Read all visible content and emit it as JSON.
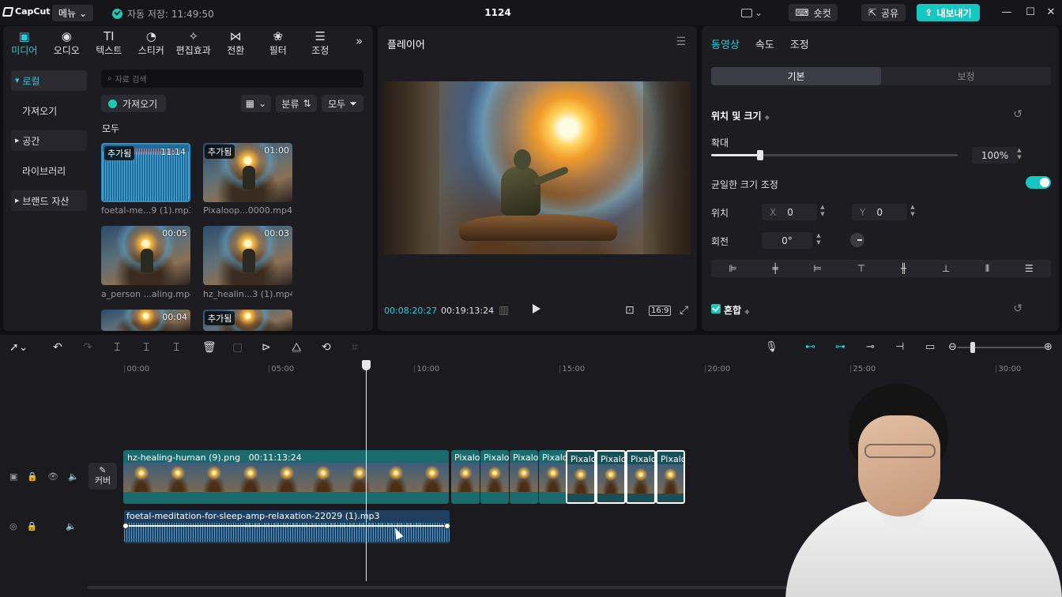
{
  "titlebar": {
    "logo": "CapCut",
    "menu": "메뉴",
    "autosave": "자동 저장: 11:49:50",
    "project": "1124",
    "shortcut": "숏컷",
    "share": "공유",
    "export": "내보내기"
  },
  "tool_tabs": [
    {
      "label": "미디어",
      "icon": "media-icon"
    },
    {
      "label": "오디오",
      "icon": "audio-icon"
    },
    {
      "label": "텍스트",
      "icon": "text-icon"
    },
    {
      "label": "스티커",
      "icon": "sticker-icon"
    },
    {
      "label": "편집효과",
      "icon": "effects-icon"
    },
    {
      "label": "전환",
      "icon": "transition-icon"
    },
    {
      "label": "필터",
      "icon": "filter-icon"
    },
    {
      "label": "조정",
      "icon": "adjust-icon"
    }
  ],
  "library": {
    "items": [
      "로컬",
      "가져오기",
      "공간",
      "라이브러리",
      "브랜드 자산"
    ],
    "search_placeholder": "자료 검색",
    "import": "가져오기",
    "sort": "분류",
    "filter": "모두",
    "all_label": "모두",
    "thumbs": [
      {
        "badge": "추가됨",
        "duration": "11:14",
        "caption": "foetal-me...9 (1).mp3",
        "kind": "audio"
      },
      {
        "badge": "추가됨",
        "duration": "01:00",
        "caption": "Pixaloop...0000.mp4",
        "kind": "video"
      },
      {
        "badge": "",
        "duration": "00:05",
        "caption": "a_person ...aling.mp4",
        "kind": "video"
      },
      {
        "badge": "",
        "duration": "00:03",
        "caption": "hz_healin...3 (1).mp4",
        "kind": "video"
      },
      {
        "badge": "",
        "duration": "00:04",
        "caption": "",
        "kind": "video"
      },
      {
        "badge": "추가됨",
        "duration": "",
        "caption": "",
        "kind": "video"
      }
    ]
  },
  "player": {
    "title": "플레이어",
    "current_time": "00:08:20:27",
    "total_time": "00:19:13:24",
    "ratio": "16:9"
  },
  "properties": {
    "tabs": [
      "동영상",
      "속도",
      "조정"
    ],
    "segments": [
      "기본",
      "보정"
    ],
    "section_position": "위치 및 크기",
    "scale_label": "확대",
    "scale_value": "100%",
    "scale_fraction": 0.2,
    "uniform_label": "균일한 크기 조정",
    "position_label": "위치",
    "x_axis": "X",
    "x_value": "0",
    "y_axis": "Y",
    "y_value": "0",
    "rotation_label": "회전",
    "rotation_value": "0°",
    "blend_label": "혼합"
  },
  "timeline": {
    "ruler": [
      "00:00",
      "05:00",
      "10:00",
      "15:00",
      "20:00",
      "25:00",
      "30:00"
    ],
    "cover": "커버",
    "main_clip_name": "hz-healing-human (9).png",
    "main_clip_duration": "00:11:13:24",
    "small_clip_label": "Pixalo",
    "audio_clip_name": "foetal-meditation-for-sleep-amp-relaxation-22029 (1).mp3"
  }
}
